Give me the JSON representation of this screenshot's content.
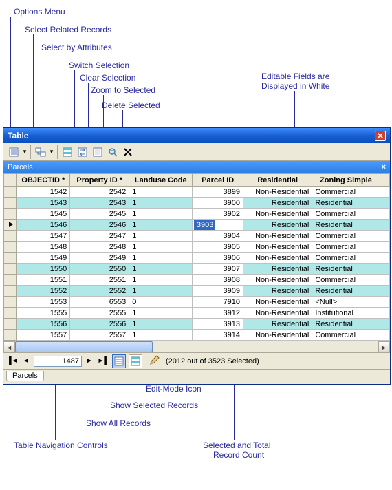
{
  "annotations": {
    "options_menu": "Options Menu",
    "select_related": "Select Related Records",
    "select_by_attr": "Select by Attributes",
    "switch_selection": "Switch Selection",
    "clear_selection": "Clear Selection",
    "zoom_to_selected": "Zoom to Selected",
    "delete_selected": "Delete Selected",
    "editable_fields": "Editable Fields are",
    "editable_fields2": "Displayed in White",
    "nav_controls": "Table Navigation Controls",
    "show_all": "Show All Records",
    "show_selected": "Show Selected Records",
    "edit_mode_icon": "Edit-Mode Icon",
    "sel_count": "Selected and Total",
    "sel_count2": "Record Count"
  },
  "window": {
    "title": "Table",
    "subheader": "Parcels"
  },
  "columns": [
    "OBJECTID *",
    "Property ID *",
    "Landuse Code",
    "Parcel ID",
    "Residential",
    "Zoning Simple"
  ],
  "rows": [
    {
      "sel": false,
      "oid": "1542",
      "pid": "2542",
      "lu": "1",
      "parcel": "3899",
      "res": "Non-Residential",
      "zone": "Commercial"
    },
    {
      "sel": true,
      "oid": "1543",
      "pid": "2543",
      "lu": "1",
      "parcel": "3900",
      "res": "Residential",
      "zone": "Residential"
    },
    {
      "sel": false,
      "oid": "1545",
      "pid": "2545",
      "lu": "1",
      "parcel": "3902",
      "res": "Non-Residential",
      "zone": "Commercial"
    },
    {
      "sel": true,
      "oid": "1546",
      "pid": "2546",
      "lu": "1",
      "parcel": "3903",
      "res": "Residential",
      "zone": "Residential",
      "editrow": true
    },
    {
      "sel": false,
      "oid": "1547",
      "pid": "2547",
      "lu": "1",
      "parcel": "3904",
      "res": "Non-Residential",
      "zone": "Commercial"
    },
    {
      "sel": false,
      "oid": "1548",
      "pid": "2548",
      "lu": "1",
      "parcel": "3905",
      "res": "Non-Residential",
      "zone": "Commercial"
    },
    {
      "sel": false,
      "oid": "1549",
      "pid": "2549",
      "lu": "1",
      "parcel": "3906",
      "res": "Non-Residential",
      "zone": "Commercial"
    },
    {
      "sel": true,
      "oid": "1550",
      "pid": "2550",
      "lu": "1",
      "parcel": "3907",
      "res": "Residential",
      "zone": "Residential"
    },
    {
      "sel": false,
      "oid": "1551",
      "pid": "2551",
      "lu": "1",
      "parcel": "3908",
      "res": "Non-Residential",
      "zone": "Commercial"
    },
    {
      "sel": true,
      "oid": "1552",
      "pid": "2552",
      "lu": "1",
      "parcel": "3909",
      "res": "Residential",
      "zone": "Residential"
    },
    {
      "sel": false,
      "oid": "1553",
      "pid": "6553",
      "lu": "0",
      "parcel": "7910",
      "res": "Non-Residential",
      "zone": "<Null>"
    },
    {
      "sel": false,
      "oid": "1555",
      "pid": "2555",
      "lu": "1",
      "parcel": "3912",
      "res": "Non-Residential",
      "zone": "Institutional"
    },
    {
      "sel": true,
      "oid": "1556",
      "pid": "2556",
      "lu": "1",
      "parcel": "3913",
      "res": "Residential",
      "zone": "Residential"
    },
    {
      "sel": false,
      "oid": "1557",
      "pid": "2557",
      "lu": "1",
      "parcel": "3914",
      "res": "Non-Residential",
      "zone": "Commercial"
    }
  ],
  "nav": {
    "position": "1487",
    "status": "(2012 out of 3523 Selected)"
  },
  "tab": "Parcels"
}
